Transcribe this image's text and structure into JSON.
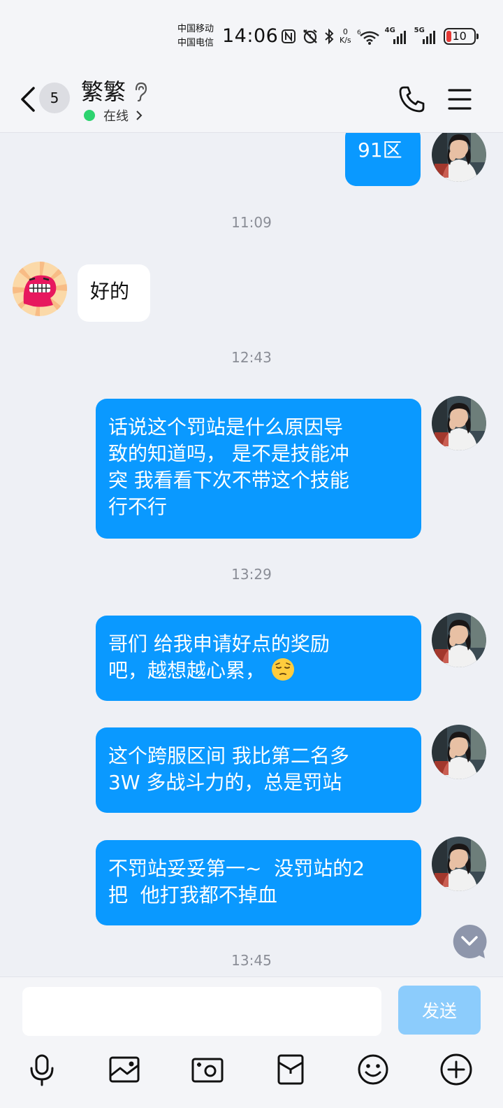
{
  "status_bar": {
    "carrier_1": "中国移动",
    "carrier_2": "中国电信",
    "time": "14:06",
    "net_speed_value": "0",
    "net_speed_unit": "K/s",
    "signal_1": "4G",
    "signal_2": "5G",
    "battery": "10",
    "icons": [
      "nfc-icon",
      "alarm-icon",
      "bluetooth-icon",
      "wifi-icon",
      "signal-icon",
      "battery-icon"
    ]
  },
  "header": {
    "unread_count": "5",
    "contact_name": "繁繁",
    "online_status": "在线",
    "icons": [
      "back-icon",
      "ear-icon",
      "call-icon",
      "menu-icon"
    ]
  },
  "messages": [
    {
      "type": "sent",
      "text": "91区"
    },
    {
      "type": "timestamp",
      "text": "11:09"
    },
    {
      "type": "received",
      "text": "好的"
    },
    {
      "type": "timestamp",
      "text": "12:43"
    },
    {
      "type": "sent",
      "lines": [
        "话说这个罚站是什么原因导",
        "致的知道吗， 是不是技能冲",
        "突 我看看下次不带这个技能",
        "行不行"
      ]
    },
    {
      "type": "timestamp",
      "text": "13:29"
    },
    {
      "type": "sent",
      "lines": [
        "哥们 给我申请好点的奖励",
        "吧，越想越心累，"
      ],
      "emoji": "pensive-face-emoji"
    },
    {
      "type": "sent",
      "lines": [
        "这个跨服区间 我比第二名多",
        "3W 多战斗力的，总是罚站"
      ]
    },
    {
      "type": "sent",
      "lines": [
        "不罚站妥妥第一~  没罚站的2",
        "把  他打我都不掉血"
      ]
    },
    {
      "type": "timestamp",
      "text": "13:45"
    }
  ],
  "input": {
    "placeholder": "",
    "send_label": "发送"
  },
  "toolbar": [
    "microphone-icon",
    "image-icon",
    "camera-icon",
    "red-packet-icon",
    "emoji-icon",
    "plus-icon"
  ],
  "colors": {
    "sent_bubble": "#0a99ff",
    "received_bubble": "#ffffff",
    "background": "#eef0f5",
    "send_button_disabled": "#8cccfc",
    "online": "#2dd36f",
    "battery_low": "#e53935"
  }
}
